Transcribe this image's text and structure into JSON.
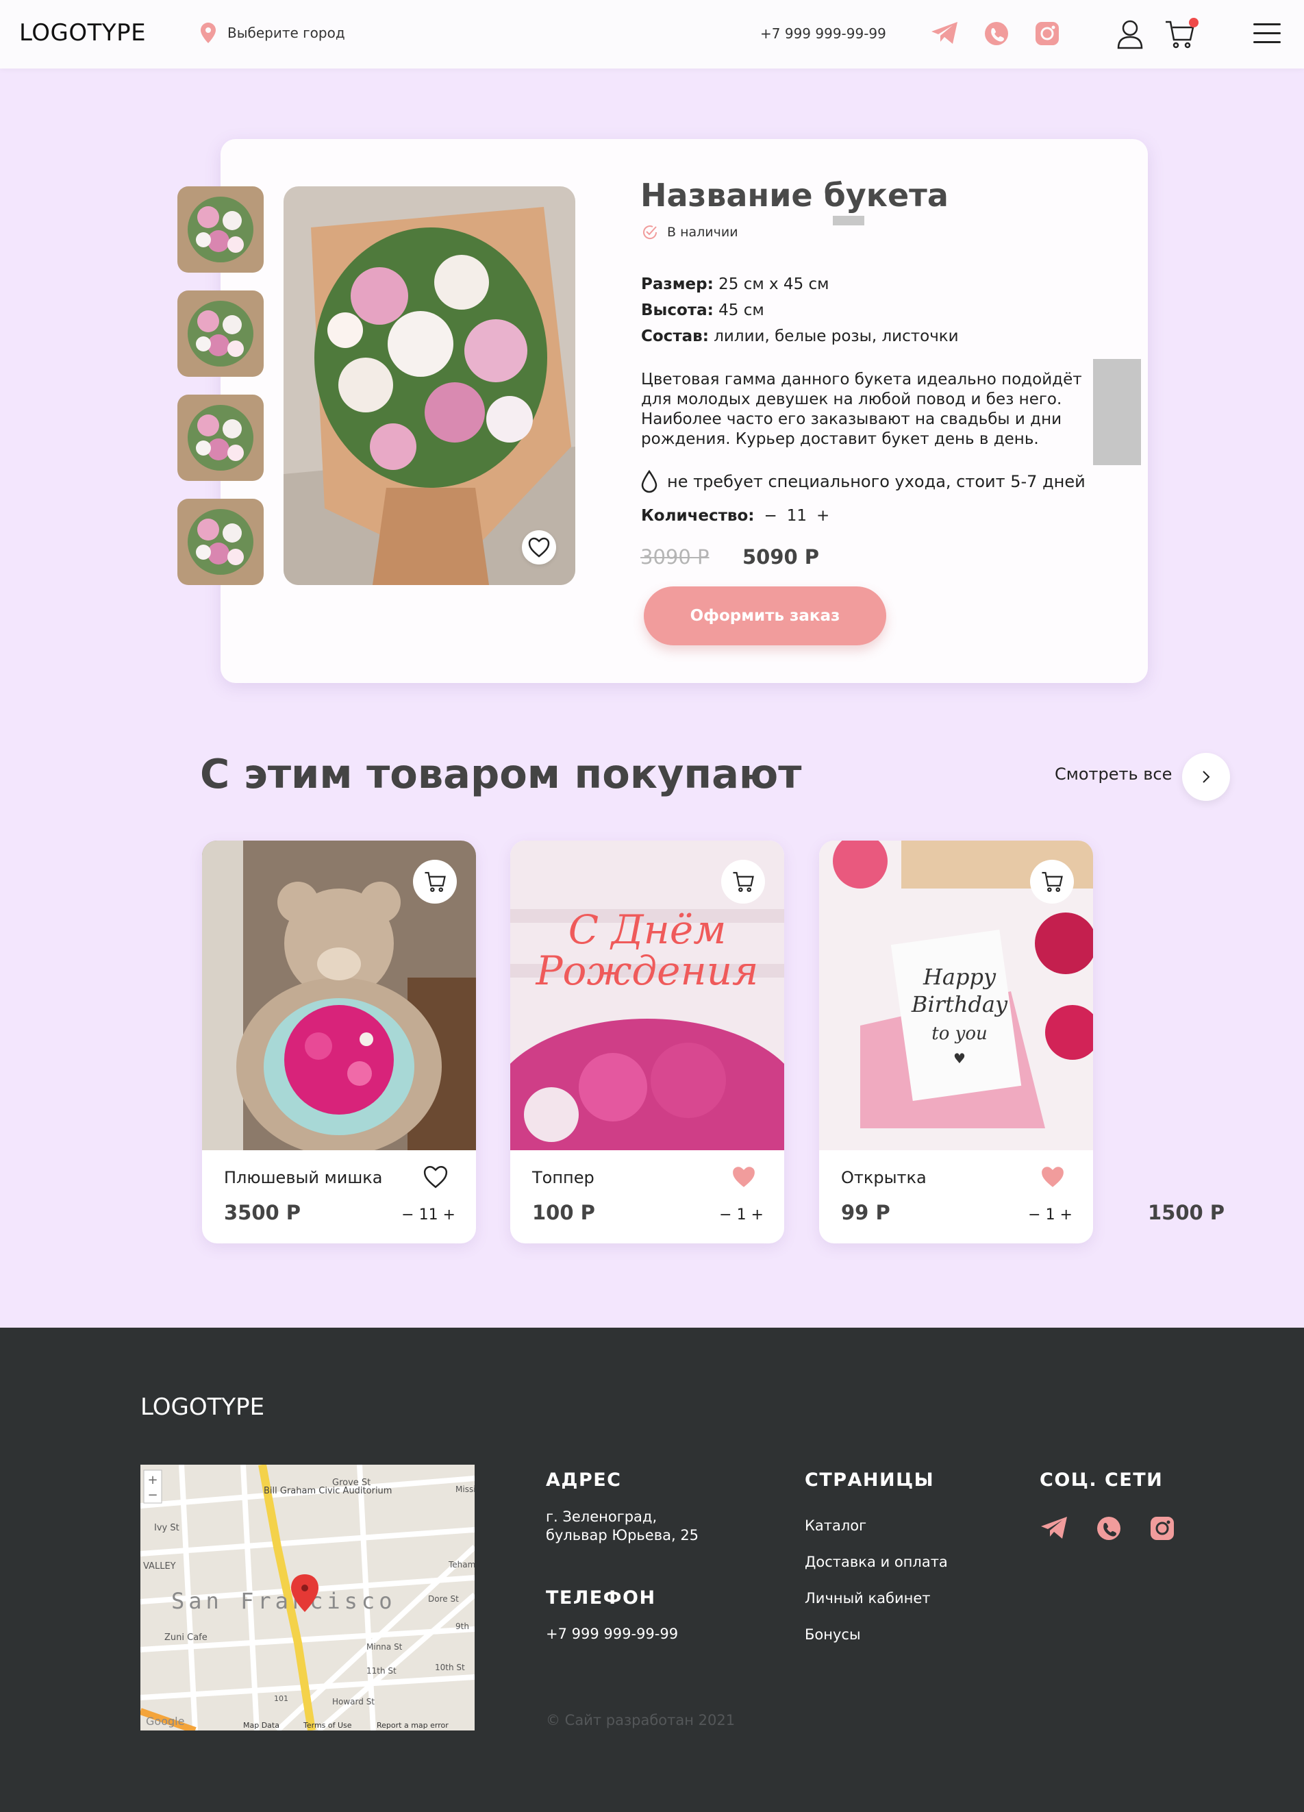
{
  "header": {
    "logo": "LOGOTYPE",
    "city_label": "Выберите город",
    "phone": "+7 999 999-99-99",
    "icons": [
      "map-pin-icon",
      "telegram-icon",
      "whatsapp-icon",
      "instagram-icon",
      "user-icon",
      "cart-icon",
      "menu-icon"
    ]
  },
  "product": {
    "title": "Название букета",
    "stock": "В наличии",
    "size_label": "Размер:",
    "size_value": "25 см х 45 см",
    "height_label": "Высота:",
    "height_value": "45 см",
    "composition_label": "Состав:",
    "composition_value": "лилии, белые розы, листочки",
    "description": "Цветовая гамма данного букета идеально подойдёт для молодых девушек на любой повод и без него. Наиболее часто его заказывают на свадьбы и дни рождения. Курьер доставит букет день в день.",
    "care": "не требует специального ухода, стоит 5-7 дней",
    "quantity_label": "Количество:",
    "quantity_minus": "−",
    "quantity_value": "11",
    "quantity_plus": "+",
    "old_price": "3090 Р",
    "new_price": "5090 Р",
    "order_button": "Оформить заказ"
  },
  "related": {
    "title": "С этим товаром покупают",
    "see_all": "Смотреть все",
    "items": [
      {
        "name": "Плюшевый мишка",
        "price": "3500 Р",
        "qty": "− 11 +",
        "favorite": false
      },
      {
        "name": "Топпер",
        "price": "100 Р",
        "qty": "− 1 +",
        "favorite": true
      },
      {
        "name": "Открытка",
        "price": "99 Р",
        "qty": "− 1 +",
        "favorite": true
      }
    ],
    "extra_price": "1500 Р"
  },
  "footer": {
    "logo": "LOGOTYPE",
    "address_heading": "АДРЕС",
    "address_line1": "г. Зеленоград,",
    "address_line2": "бульвар Юрьева, 25",
    "phone_heading": "ТЕЛЕФОН",
    "phone": "+7 999 999-99-99",
    "pages_heading": "СТРАНИЦЫ",
    "pages": [
      "Каталог",
      "Доставка и оплата",
      "Личный кабинет",
      "Бонусы"
    ],
    "social_heading": "СОЦ. СЕТИ",
    "copyright": "© Сайт разработан 2021",
    "map": {
      "city": "San Francisco",
      "labels": [
        "Bill Graham Civic Auditorium",
        "Grove St",
        "Ivy St",
        "VALLEY",
        "Zuni Cafe",
        "Mission St",
        "Minna St",
        "11th St",
        "10th St",
        "9th",
        "Dore St",
        "Tehama",
        "Howard St",
        "101",
        "Google",
        "Map Data",
        "Terms of Use",
        "Report a map error"
      ]
    }
  },
  "colors": {
    "background": "#f3e6fd",
    "accent": "#f19c9c",
    "footer": "#2f3233",
    "card": "#fefcfe"
  }
}
